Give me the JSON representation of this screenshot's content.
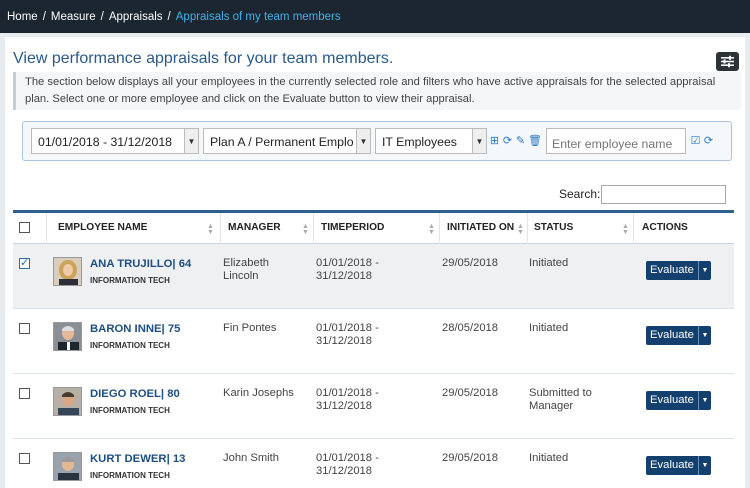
{
  "breadcrumb": [
    "Home",
    "Measure",
    "Appraisals",
    "Appraisals of my team members"
  ],
  "page": {
    "title": "View performance appraisals for your team members.",
    "description": "The section below displays all your employees in the currently selected role and filters who have active appraisals for the selected appraisal plan. Select one or more employee and click on the Evaluate button to view their appraisal."
  },
  "filters": {
    "period": "01/01/2018 - 31/12/2018",
    "plan": "Plan A / Permanent Emplo",
    "group": "IT Employees",
    "employee_placeholder": "Enter employee name"
  },
  "search": {
    "label": "Search:",
    "value": ""
  },
  "table": {
    "columns": [
      "EMPLOYEE NAME",
      "MANAGER",
      "TIMEPERIOD",
      "INITIATED ON",
      "STATUS",
      "ACTIONS"
    ],
    "rows": [
      {
        "name": "ANA TRUJILLO| 64",
        "dept": "INFORMATION TECH",
        "manager": "Elizabeth Lincoln",
        "period": "01/01/2018 - 31/12/2018",
        "initiated": "29/05/2018",
        "status": "Initiated",
        "action": "Evaluate",
        "checked": true
      },
      {
        "name": "BARON INNE| 75",
        "dept": "INFORMATION TECH",
        "manager": "Fin Pontes",
        "period": "01/01/2018 - 31/12/2018",
        "initiated": "28/05/2018",
        "status": "Initiated",
        "action": "Evaluate",
        "checked": false
      },
      {
        "name": "DIEGO ROEL| 80",
        "dept": "INFORMATION TECH",
        "manager": "Karin Josephs",
        "period": "01/01/2018 - 31/12/2018",
        "initiated": "29/05/2018",
        "status": "Submitted to Manager",
        "action": "Evaluate",
        "checked": false
      },
      {
        "name": "KURT DEWER| 13",
        "dept": "INFORMATION TECH",
        "manager": "John Smith",
        "period": "01/01/2018 - 31/12/2018",
        "initiated": "29/05/2018",
        "status": "Initiated",
        "action": "Evaluate",
        "checked": false
      }
    ]
  },
  "colors": {
    "topbar": "#1b2631",
    "accent": "#2a5a8a",
    "button": "#13406e",
    "active_crumb": "#43b0e6"
  }
}
